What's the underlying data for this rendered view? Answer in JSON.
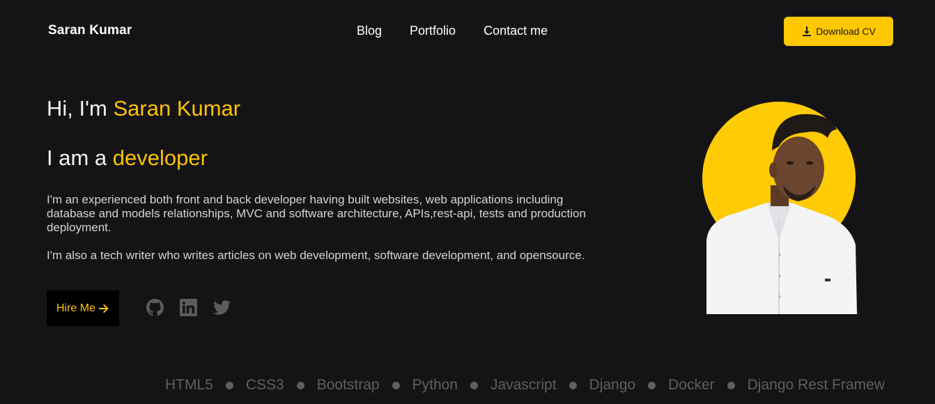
{
  "header": {
    "logo": "Saran Kumar",
    "nav": [
      "Blog",
      "Portfolio",
      "Contact me"
    ],
    "cv_label": "Download CV"
  },
  "hero": {
    "greeting_prefix": "Hi, I'm",
    "name": "Saran Kumar",
    "role_prefix": "I am a",
    "role": "developer",
    "paragraph_1": "I'm an experienced both front and back developer having built websites, web applications including database and models relationships, MVC and software architecture, APIs,rest-api, tests and production deployment.",
    "paragraph_2": "I'm also a tech writer who writes articles on web development, software development, and opensource.",
    "hire_label": "Hire Me"
  },
  "social": [
    "github-icon",
    "linkedin-icon",
    "twitter-icon"
  ],
  "skills": [
    "HTML5",
    "CSS3",
    "Bootstrap",
    "Python",
    "Javascript",
    "Django",
    "Docker",
    "Django Rest Framew"
  ],
  "colors": {
    "background": "#141416",
    "accent": "#ffc107",
    "button_yellow": "#ffc801",
    "muted": "#5f5f5f"
  }
}
